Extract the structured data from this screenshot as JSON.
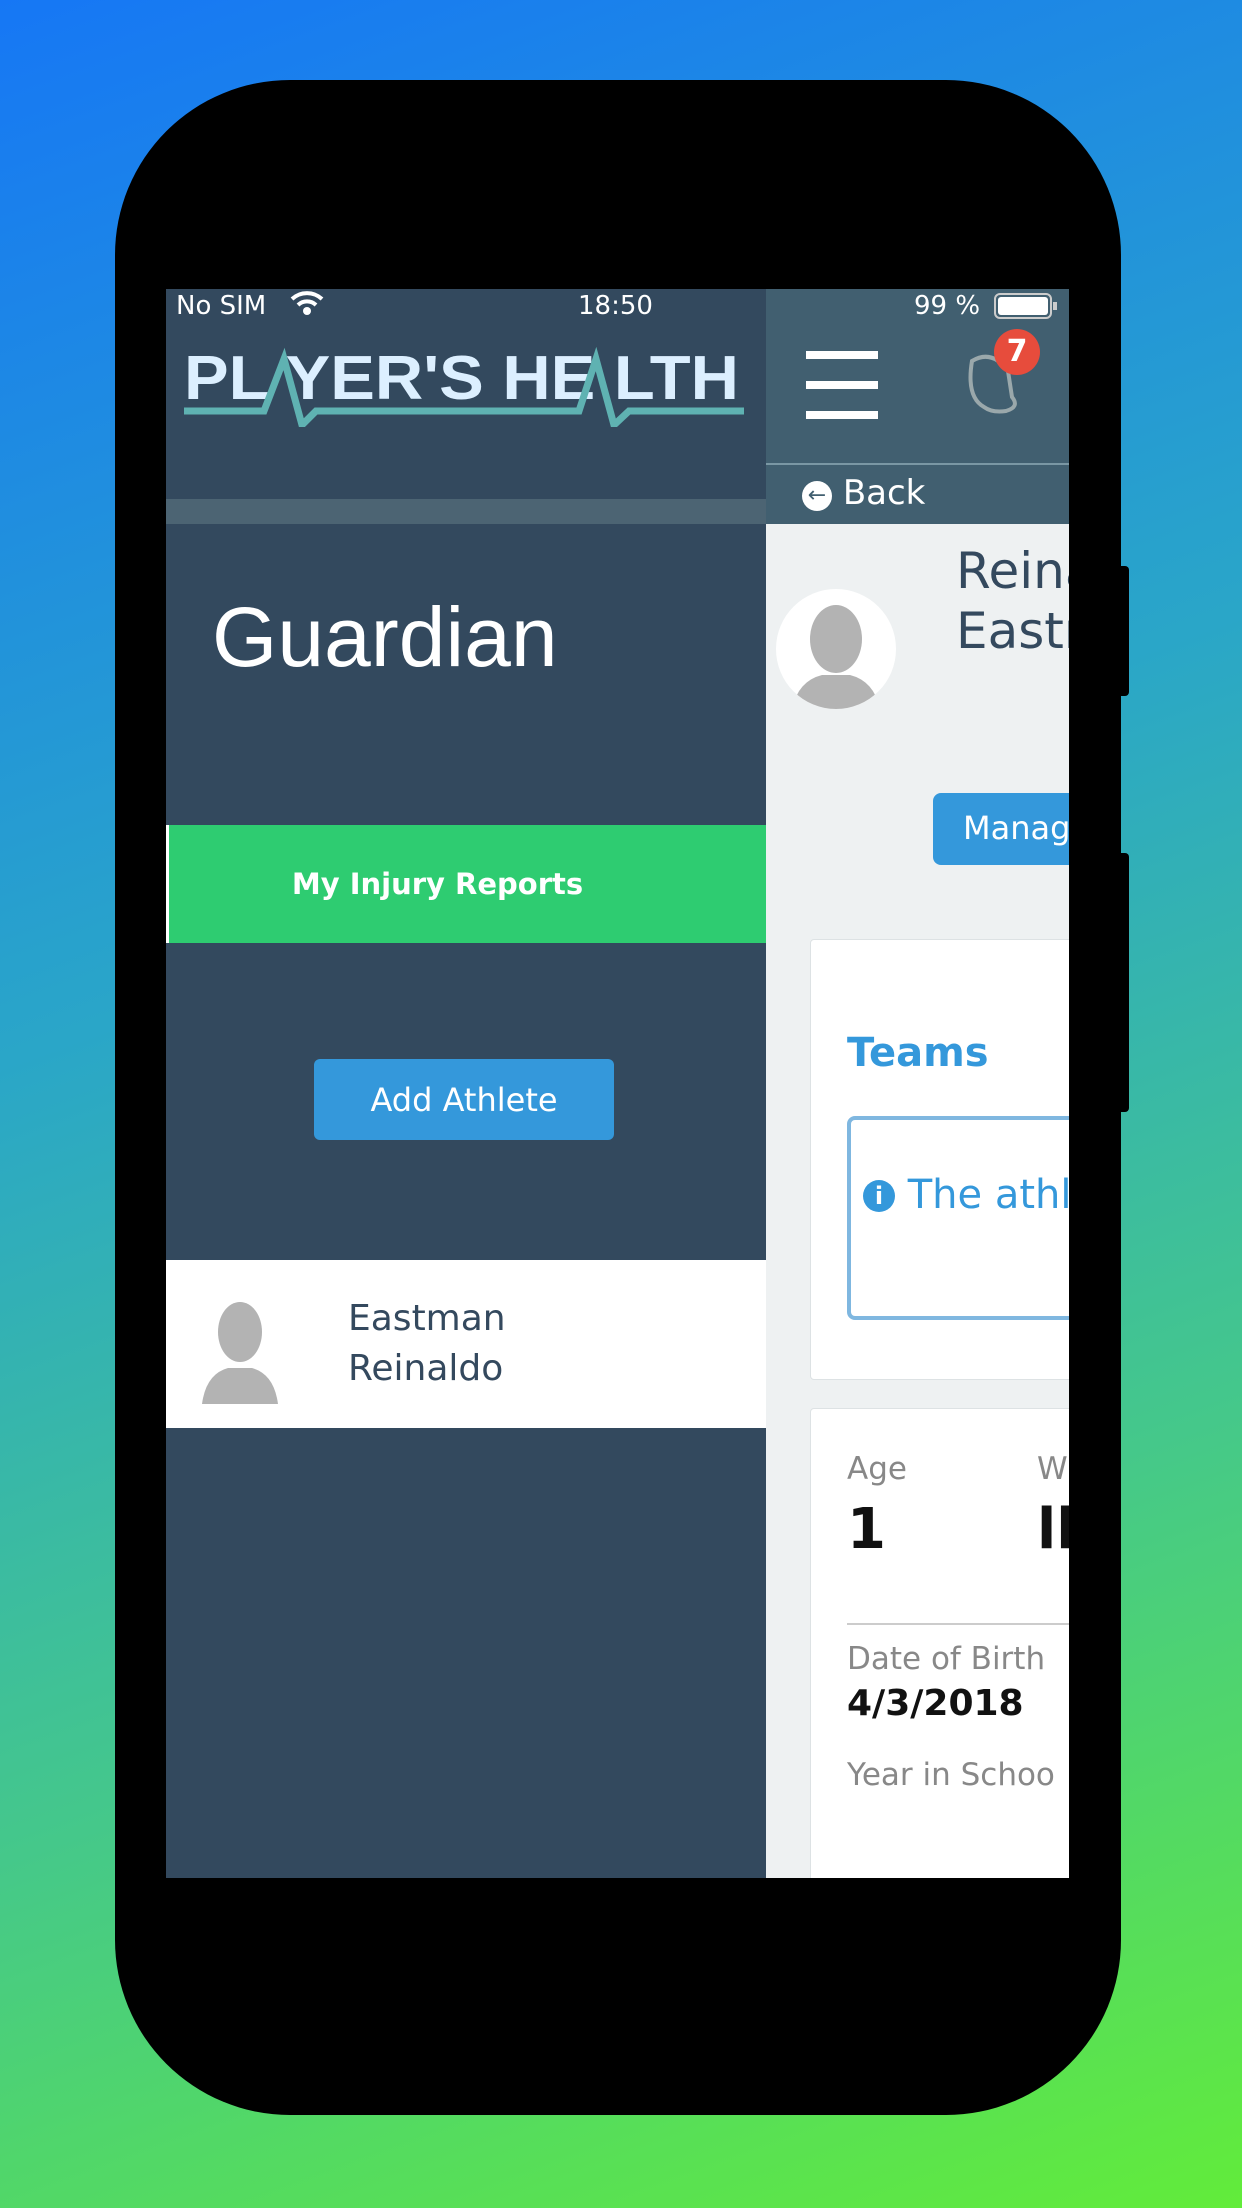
{
  "status_bar": {
    "carrier": "No SIM",
    "time": "18:50",
    "battery": "99 %"
  },
  "logo": {
    "text": "PLAYER'S HEALTH"
  },
  "sidebar": {
    "role": "Guardian",
    "menu_item": "My Injury Reports",
    "add_button": "Add Athlete",
    "athletes": [
      {
        "first": "Eastman",
        "last": "Reinaldo"
      }
    ]
  },
  "header": {
    "notification_count": "7",
    "back_label": "Back"
  },
  "profile": {
    "name_line1": "Reina",
    "name_line2": "Eastr",
    "manage_label": "Manag"
  },
  "teams": {
    "title": "Teams",
    "info": "The athl"
  },
  "details": {
    "age_label": "Age",
    "age_value": "1",
    "weight_label": "W",
    "weight_value": "lb",
    "dob_label": "Date of Birth",
    "dob_value": "4/3/2018",
    "year_label": "Year in Schoo"
  },
  "colors": {
    "sidebar": "#33495e",
    "header": "#415f70",
    "accent": "#3498db",
    "green": "#2ecc71",
    "badge": "#e74c3c"
  }
}
